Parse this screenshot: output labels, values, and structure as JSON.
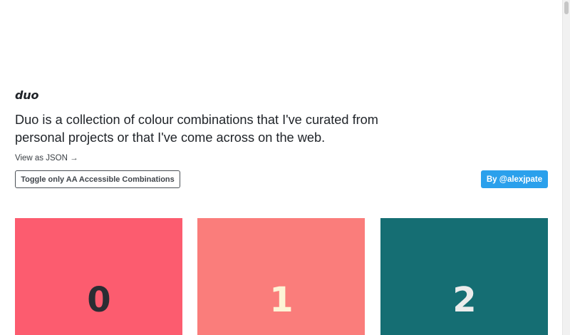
{
  "header": {
    "brand": "duo",
    "description": "Duo is a collection of colour combinations that I've curated from personal projects or that I've come across on the web.",
    "json_link": "View as JSON →"
  },
  "actions": {
    "toggle_label": "Toggle only AA Accessible Combinations",
    "author_label": "By @alexjpate"
  },
  "combinations": [
    {
      "label": "0",
      "background": "#fc5c6f",
      "foreground": "#2a2d33"
    },
    {
      "label": "1",
      "background": "#fa7d7b",
      "foreground": "#fdf4d6"
    },
    {
      "label": "2",
      "background": "#156e73",
      "foreground": "#ececec"
    }
  ],
  "colors": {
    "accent": "#2aa0ec",
    "text": "#1f2328"
  }
}
